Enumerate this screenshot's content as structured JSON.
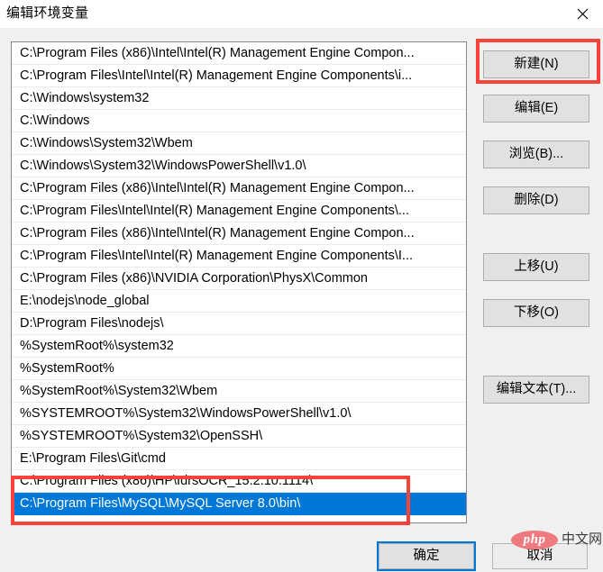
{
  "window": {
    "title": "编辑环境变量",
    "close_label": "✕"
  },
  "list": {
    "items": [
      "C:\\Program Files (x86)\\Intel\\Intel(R) Management Engine Compon...",
      "C:\\Program Files\\Intel\\Intel(R) Management Engine Components\\i...",
      "C:\\Windows\\system32",
      "C:\\Windows",
      "C:\\Windows\\System32\\Wbem",
      "C:\\Windows\\System32\\WindowsPowerShell\\v1.0\\",
      "C:\\Program Files (x86)\\Intel\\Intel(R) Management Engine Compon...",
      "C:\\Program Files\\Intel\\Intel(R) Management Engine Components\\...",
      "C:\\Program Files (x86)\\Intel\\Intel(R) Management Engine Compon...",
      "C:\\Program Files\\Intel\\Intel(R) Management Engine Components\\I...",
      "C:\\Program Files (x86)\\NVIDIA Corporation\\PhysX\\Common",
      "E:\\nodejs\\node_global",
      "D:\\Program Files\\nodejs\\",
      "%SystemRoot%\\system32",
      "%SystemRoot%",
      "%SystemRoot%\\System32\\Wbem",
      "%SYSTEMROOT%\\System32\\WindowsPowerShell\\v1.0\\",
      "%SYSTEMROOT%\\System32\\OpenSSH\\",
      "E:\\Program Files\\Git\\cmd",
      "C:\\Program Files (x86)\\HP\\IdrsOCR_15.2.10.1114\\",
      "C:\\Program Files\\MySQL\\MySQL Server 8.0\\bin\\",
      ""
    ],
    "selected_index": 20,
    "selected_color": "#0078d7"
  },
  "side_buttons": [
    {
      "key": "new",
      "label": "新建(N)"
    },
    {
      "key": "edit",
      "label": "编辑(E)"
    },
    {
      "key": "browse",
      "label": "浏览(B)..."
    },
    {
      "key": "delete",
      "label": "删除(D)"
    },
    {
      "key": "move_up",
      "label": "上移(U)"
    },
    {
      "key": "move_down",
      "label": "下移(O)"
    },
    {
      "key": "edit_text",
      "label": "编辑文本(T)..."
    }
  ],
  "bottom_buttons": {
    "ok": "确定",
    "cancel": "取消"
  },
  "annotations": {
    "color": "#f9423a",
    "highlight_new_button": true,
    "highlight_selected_row": true
  },
  "watermark": {
    "logo_text": "php",
    "site_text": "中文网",
    "logo_color": "#ed7a7e"
  }
}
